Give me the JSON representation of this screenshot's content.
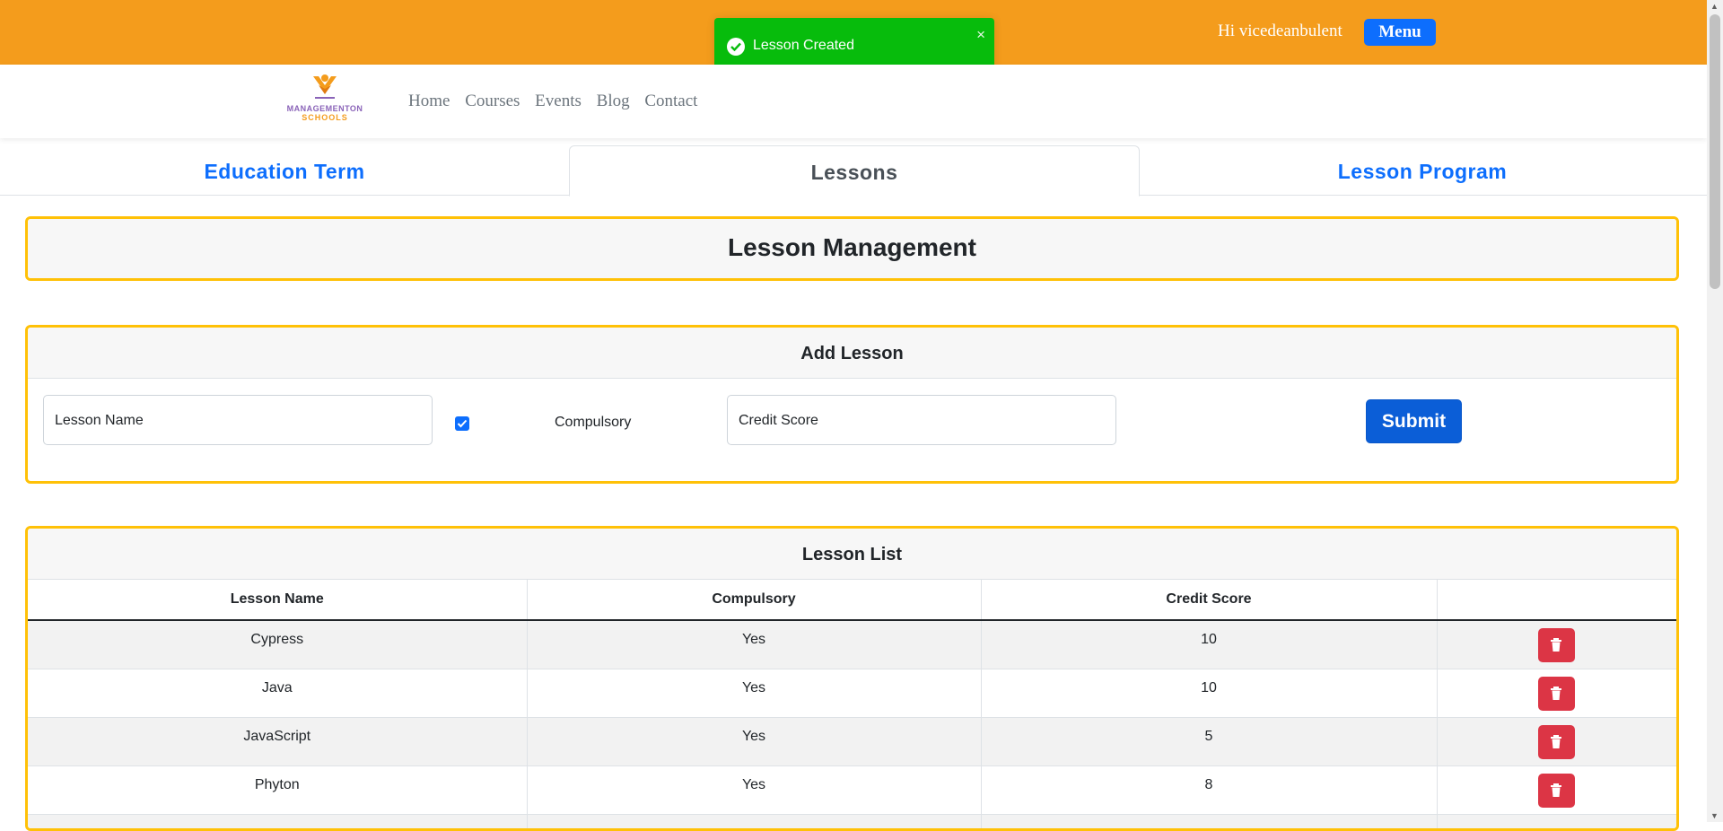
{
  "header": {
    "greeting": "Hi vicedeanbulent",
    "menu_label": "Menu"
  },
  "toast": {
    "message": "Lesson Created",
    "close": "×"
  },
  "logo": {
    "line1": "MANAGEMENTON",
    "line2": "SCHOOLS"
  },
  "nav": {
    "links": [
      "Home",
      "Courses",
      "Events",
      "Blog",
      "Contact"
    ]
  },
  "tabs": [
    {
      "label": "Education Term",
      "active": false
    },
    {
      "label": "Lessons",
      "active": true
    },
    {
      "label": "Lesson Program",
      "active": false
    }
  ],
  "page_title": "Lesson Management",
  "add_lesson": {
    "title": "Add Lesson",
    "lesson_name_placeholder": "Lesson Name",
    "compulsory_label": "Compulsory",
    "compulsory_checked": true,
    "credit_score_placeholder": "Credit Score",
    "submit_label": "Submit"
  },
  "lesson_list": {
    "title": "Lesson List",
    "columns": [
      "Lesson Name",
      "Compulsory",
      "Credit Score",
      ""
    ],
    "rows": [
      {
        "name": "Cypress",
        "compulsory": "Yes",
        "credit": "10"
      },
      {
        "name": "Java",
        "compulsory": "Yes",
        "credit": "10"
      },
      {
        "name": "JavaScript",
        "compulsory": "Yes",
        "credit": "5"
      },
      {
        "name": "Phyton",
        "compulsory": "Yes",
        "credit": "8"
      }
    ]
  },
  "colors": {
    "topbar": "#f49c1c",
    "primary": "#0d6efd",
    "card_border": "#ffc107",
    "toast_success": "#07bc0c",
    "danger": "#dc3545"
  },
  "icons": {
    "toast": "check-circle-icon",
    "close": "close-icon",
    "delete": "trash-icon",
    "checkbox": "check-icon"
  }
}
